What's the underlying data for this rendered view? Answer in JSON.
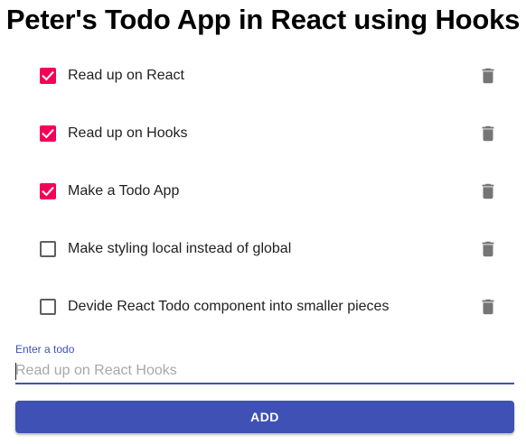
{
  "app": {
    "title": "Peter's Todo App in React using Hooks"
  },
  "todos": [
    {
      "text": "Read up on React",
      "done": true
    },
    {
      "text": "Read up on Hooks",
      "done": true
    },
    {
      "text": "Make a Todo App",
      "done": true
    },
    {
      "text": "Make styling local instead of global",
      "done": false
    },
    {
      "text": "Devide React Todo component into smaller pieces",
      "done": false
    }
  ],
  "form": {
    "label": "Enter a todo",
    "placeholder": "Read up on React Hooks",
    "value": "",
    "add_label": "ADD"
  },
  "colors": {
    "checkbox_checked": "#f50057",
    "primary": "#3f51b5",
    "delete_icon": "#757575"
  },
  "icons": {
    "check": "check-icon",
    "delete": "trash-icon"
  }
}
